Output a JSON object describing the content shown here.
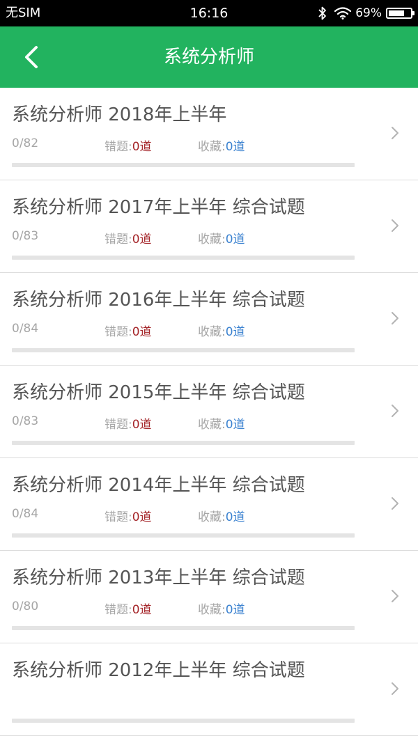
{
  "status_bar": {
    "carrier": "无SIM",
    "time": "16:16",
    "battery": "69%",
    "battery_level": 0.69,
    "icons": [
      "bluetooth-icon",
      "wifi-icon",
      "battery-icon"
    ]
  },
  "header": {
    "title": "系统分析师",
    "back_icon": "chevron-left-icon",
    "background_color": "#22b35f"
  },
  "labels": {
    "wrong": "错题:",
    "favorites": "收藏:"
  },
  "colors": {
    "accent": "#22b35f",
    "wrong_value": "#a5262a",
    "fav_value": "#3b82d0"
  },
  "exams": [
    {
      "title": "系统分析师 2018年上半年",
      "progress": "0/82",
      "wrong": "0道",
      "favorites": "0道",
      "completed_fraction": 0
    },
    {
      "title": "系统分析师 2017年上半年 综合试题",
      "progress": "0/83",
      "wrong": "0道",
      "favorites": "0道",
      "completed_fraction": 0
    },
    {
      "title": "系统分析师 2016年上半年 综合试题",
      "progress": "0/84",
      "wrong": "0道",
      "favorites": "0道",
      "completed_fraction": 0
    },
    {
      "title": "系统分析师 2015年上半年 综合试题",
      "progress": "0/83",
      "wrong": "0道",
      "favorites": "0道",
      "completed_fraction": 0
    },
    {
      "title": "系统分析师 2014年上半年 综合试题",
      "progress": "0/84",
      "wrong": "0道",
      "favorites": "0道",
      "completed_fraction": 0
    },
    {
      "title": "系统分析师 2013年上半年 综合试题",
      "progress": "0/80",
      "wrong": "0道",
      "favorites": "0道",
      "completed_fraction": 0
    },
    {
      "title": "系统分析师 2012年上半年 综合试题",
      "progress": "",
      "wrong": "",
      "favorites": "",
      "completed_fraction": 0
    }
  ]
}
